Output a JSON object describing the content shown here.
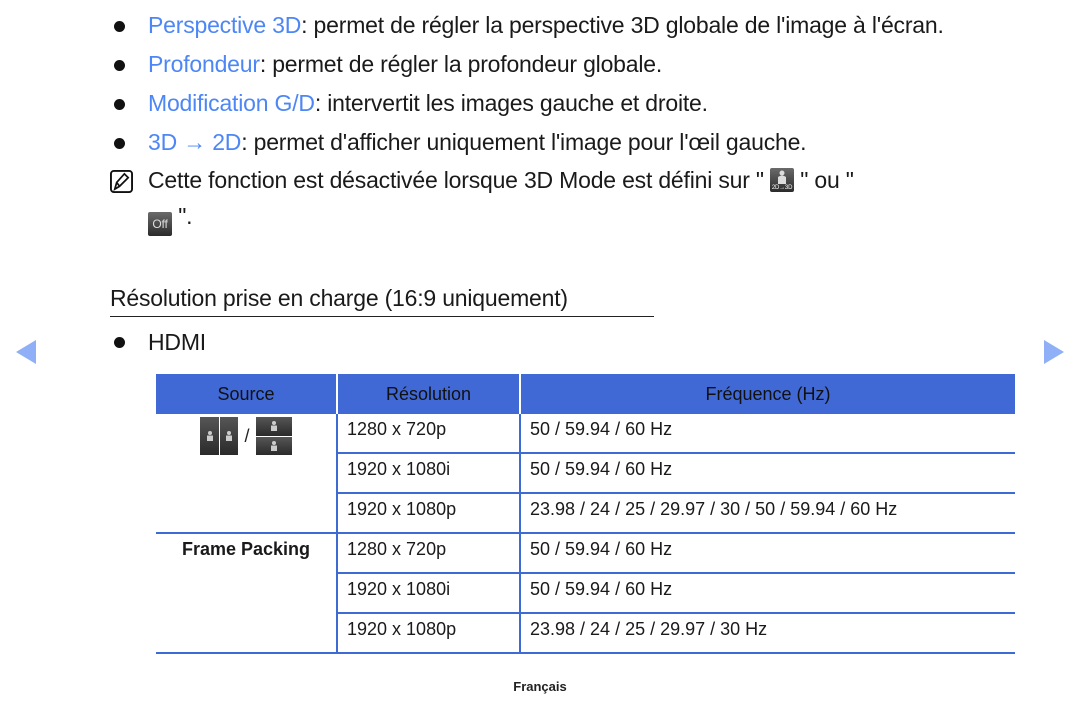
{
  "bullets": [
    {
      "keyword": "Perspective 3D",
      "text": ": permet de régler la perspective 3D globale de l'image à l'écran."
    },
    {
      "keyword": "Profondeur",
      "text": ": permet de régler la profondeur globale."
    },
    {
      "keyword": "Modification G/D",
      "text": ": intervertit les images gauche et droite."
    },
    {
      "keyword_a": "3D",
      "arrow": " → ",
      "keyword_b": "2D",
      "text": ": permet d'afficher uniquement l'image pour l'œil gauche."
    }
  ],
  "note": {
    "icon": "note-icon",
    "text_before": "Cette fonction est désactivée lorsque 3D Mode est défini sur \"",
    "text_middle": " \" ou \"",
    "text_after": " \".",
    "icon1_label": "2D→3D",
    "icon2_label": "Off"
  },
  "section_title": "Résolution prise en charge (16:9 uniquement)",
  "hdmi_label": "HDMI",
  "table": {
    "headers": [
      "Source",
      "Résolution",
      "Fréquence (Hz)"
    ],
    "source_separator": "/",
    "groups": [
      {
        "source": "side-by-side / top-bottom icons",
        "rows": [
          {
            "resolution": "1280 x 720p",
            "frequency": "50 / 59.94 / 60 Hz"
          },
          {
            "resolution": "1920 x 1080i",
            "frequency": "50 / 59.94 / 60 Hz"
          },
          {
            "resolution": "1920 x 1080p",
            "frequency": "23.98 / 24 / 25 / 29.97 / 30 / 50 / 59.94 / 60 Hz"
          }
        ]
      },
      {
        "source": "Frame Packing",
        "rows": [
          {
            "resolution": "1280 x 720p",
            "frequency": "50 / 59.94 / 60 Hz"
          },
          {
            "resolution": "1920 x 1080i",
            "frequency": "50 / 59.94 / 60 Hz"
          },
          {
            "resolution": "1920 x 1080p",
            "frequency": "23.98 / 24 / 25 / 29.97 / 30 Hz"
          }
        ]
      }
    ]
  },
  "navigation": {
    "prev_icon": "triangle-left-icon",
    "next_icon": "triangle-right-icon"
  },
  "footer": "Français",
  "colors": {
    "keyword": "#4d86f5",
    "table_header": "#4169d6",
    "table_border": "#3e6bd3",
    "nav_arrow": "#8fb0f7"
  }
}
